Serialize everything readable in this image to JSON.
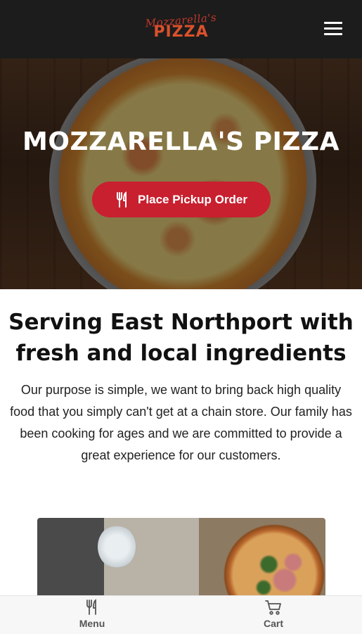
{
  "header": {
    "logo_script": "Mozzarella's",
    "logo_main": "PIZZA"
  },
  "hero": {
    "title": "MOZZARELLA'S PIZZA",
    "order_button_label": "Place Pickup Order",
    "order_button_icon": "fork-knife-icon"
  },
  "content": {
    "heading": "Serving East Northport with fresh and local ingredients",
    "paragraph": "Our purpose is simple, we want to bring back high quality food that you simply can't get at a chain store. Our family has been cooking for ages and we are committed to provide a great experience for our customers."
  },
  "bottom_nav": {
    "items": [
      {
        "label": "Menu",
        "icon": "fork-knife-icon"
      },
      {
        "label": "Cart",
        "icon": "cart-icon"
      }
    ]
  },
  "colors": {
    "header_bg": "#1c1c1c",
    "logo": "#d9512c",
    "accent_button": "#c8202f"
  }
}
